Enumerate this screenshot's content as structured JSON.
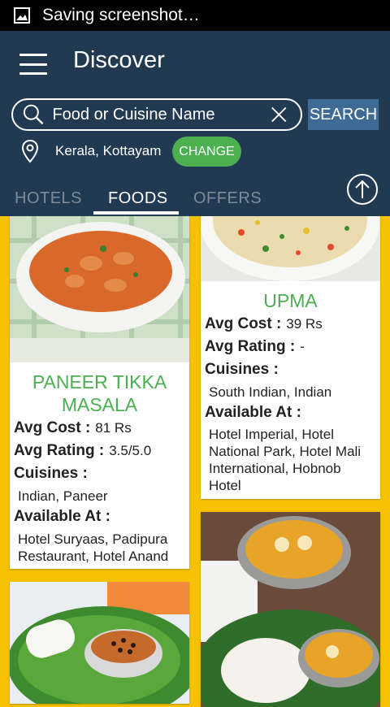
{
  "status_bar": {
    "text": "Saving screenshot…",
    "icon": "image-icon"
  },
  "header": {
    "title": "Discover"
  },
  "search": {
    "placeholder": "Food or Cuisine Name",
    "value": "",
    "button_label": "SEARCH"
  },
  "location": {
    "text": "Kerala, Kottayam",
    "change_label": "CHANGE"
  },
  "tabs": [
    {
      "label": "HOTELS",
      "active": false
    },
    {
      "label": "FOODS",
      "active": true
    },
    {
      "label": "OFFERS",
      "active": false
    }
  ],
  "labels": {
    "avg_cost": "Avg Cost :",
    "avg_rating": "Avg Rating :",
    "cuisines": "Cuisines :",
    "available_at": "Available At :"
  },
  "foods": [
    {
      "name": "PANEER TIKKA MASALA",
      "avg_cost": "81 Rs",
      "avg_rating": "3.5/5.0",
      "cuisines": "Indian, Paneer",
      "available_at": "Hotel Suryaas, Padipura Restaurant, Hotel Anand"
    },
    {
      "name": "UPMA",
      "avg_cost": "39 Rs",
      "avg_rating": "-",
      "cuisines": "South Indian, Indian",
      "available_at": "Hotel Imperial, Hotel National Park, Hotel Mali International, Hobnob Hotel"
    }
  ],
  "colors": {
    "header": "#213a52",
    "accent_green": "#4caf50",
    "background": "#f6c200",
    "search_button": "#3e6a96"
  }
}
